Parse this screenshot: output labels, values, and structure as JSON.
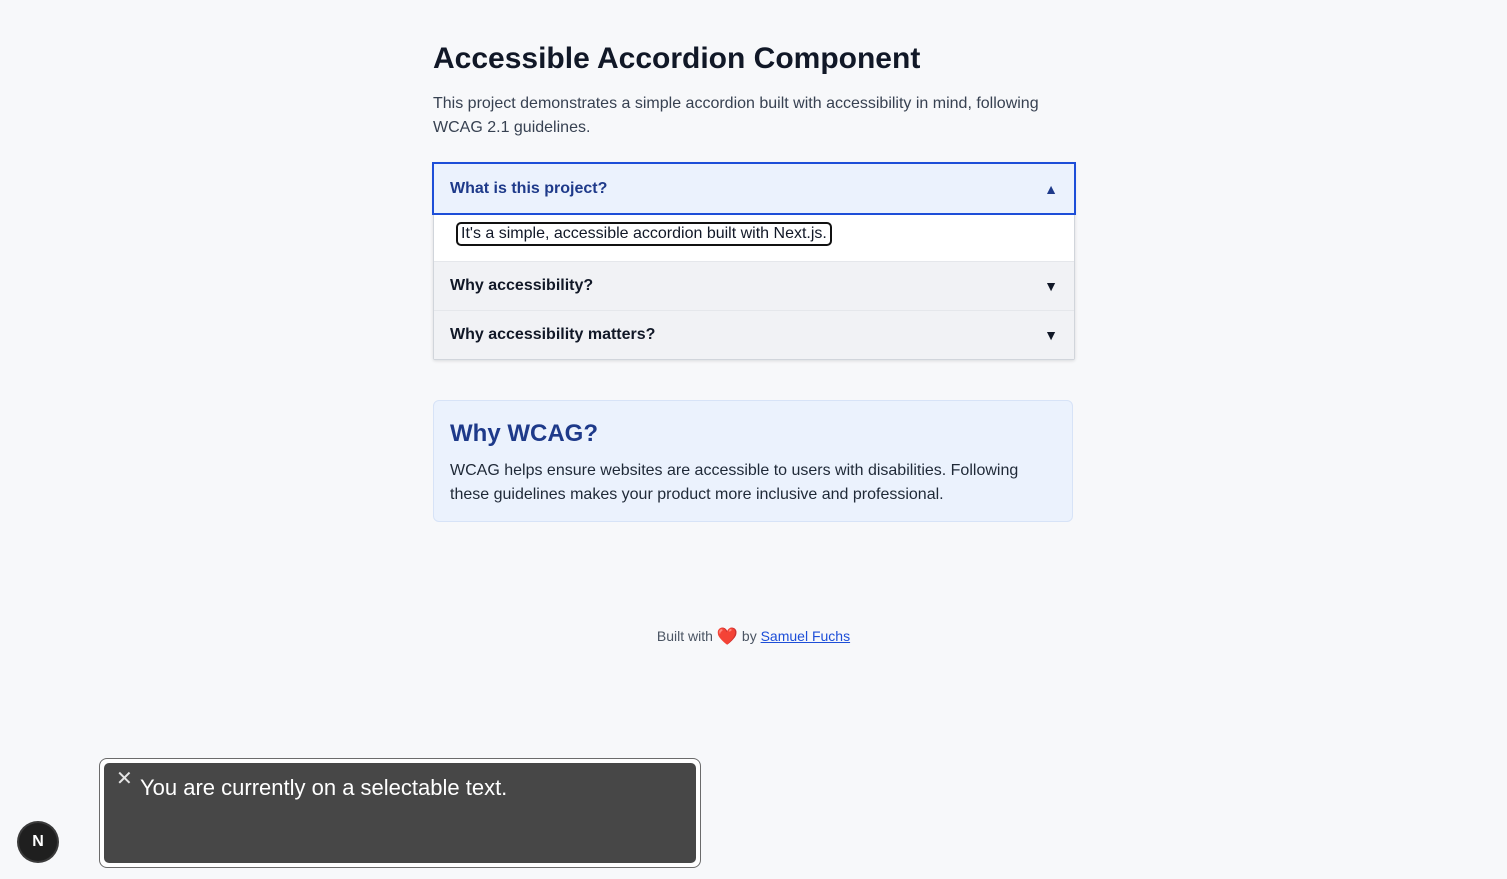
{
  "page": {
    "title": "Accessible Accordion Component",
    "intro": "This project demonstrates a simple accordion built with accessibility in mind, following WCAG 2.1 guidelines."
  },
  "accordion": {
    "items": [
      {
        "label": "What is this project?",
        "expanded": true,
        "icon": "chevron-up-icon",
        "chevron": "▲",
        "content": "It's a simple, accessible accordion built with Next.js."
      },
      {
        "label": "Why accessibility?",
        "expanded": false,
        "icon": "chevron-down-icon",
        "chevron": "▼"
      },
      {
        "label": "Why accessibility matters?",
        "expanded": false,
        "icon": "chevron-down-icon",
        "chevron": "▼"
      }
    ]
  },
  "why_card": {
    "title": "Why WCAG?",
    "body": "WCAG helps ensure websites are accessible to users with disabilities. Following these guidelines makes your product more inclusive and professional."
  },
  "footer": {
    "prefix": "Built with",
    "heart": "❤️",
    "by": "by",
    "author": "Samuel Fuchs"
  },
  "next_badge": {
    "letter": "N"
  },
  "screen_reader_toast": {
    "close_glyph": "✕",
    "text": "You are currently on a selectable text."
  },
  "colors": {
    "accent": "#1d4ed8",
    "accent_dark": "#1e3a8a",
    "panel_bg": "#ebf2fd",
    "heart": "#e11d2e"
  }
}
